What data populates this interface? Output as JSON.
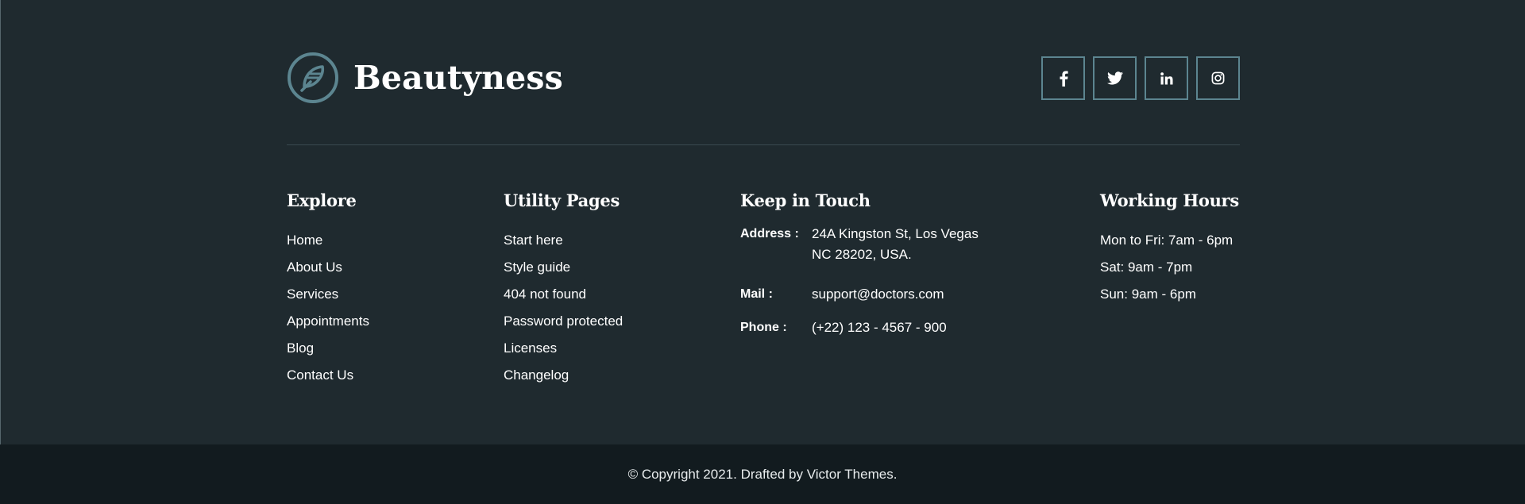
{
  "brand": {
    "name": "Beautyness",
    "logo_icon": "feather-leaf-icon",
    "logo_color": "#5c8590"
  },
  "social": [
    {
      "name": "facebook",
      "icon": "facebook-icon"
    },
    {
      "name": "twitter",
      "icon": "twitter-icon"
    },
    {
      "name": "linkedin",
      "icon": "linkedin-icon"
    },
    {
      "name": "instagram",
      "icon": "instagram-icon"
    }
  ],
  "explore": {
    "heading": "Explore",
    "links": [
      "Home",
      "About Us",
      "Services",
      "Appointments",
      "Blog",
      "Contact Us"
    ]
  },
  "utility": {
    "heading": "Utility Pages",
    "links": [
      "Start here",
      "Style guide",
      "404 not found",
      "Password protected",
      "Licenses",
      "Changelog"
    ]
  },
  "contact": {
    "heading": "Keep in Touch",
    "address_label": "Address :",
    "address_line1": "24A Kingston St, Los Vegas",
    "address_line2": "NC 28202, USA.",
    "mail_label": "Mail :",
    "mail_value": "support@doctors.com",
    "phone_label": "Phone :",
    "phone_value": "(+22) 123 - 4567 - 900"
  },
  "hours": {
    "heading": "Working Hours",
    "items": [
      "Mon to Fri: 7am - 6pm",
      "Sat: 9am - 7pm",
      "Sun: 9am - 6pm"
    ]
  },
  "footer": {
    "copyright": "© Copyright 2021. Drafted by Victor Themes."
  },
  "colors": {
    "background": "#1f2a2f",
    "bottom_bar": "#121b1f",
    "accent": "#5c8590"
  }
}
